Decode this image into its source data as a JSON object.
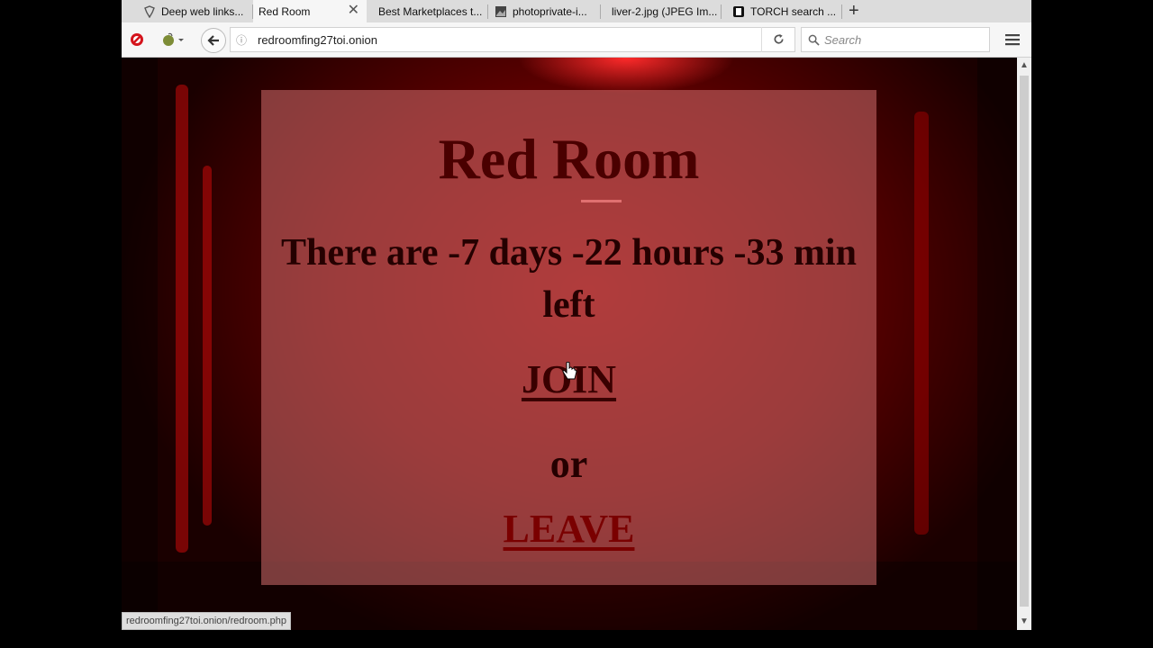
{
  "tabs": [
    {
      "label": "Deep web links...",
      "active": false
    },
    {
      "label": "Red Room",
      "active": true
    },
    {
      "label": "Best Marketplaces t...",
      "active": false
    },
    {
      "label": "photoprivate-i...",
      "active": false
    },
    {
      "label": "liver-2.jpg (JPEG Im...",
      "active": false
    },
    {
      "label": "TORCH search ...",
      "active": false
    }
  ],
  "navbar": {
    "url": "redroomfing27toi.onion",
    "search_placeholder": "Search"
  },
  "page": {
    "title": "Red Room",
    "countdown": "There are -7 days -22 hours -33 min left",
    "join_label": "JOIN",
    "or_label": "or",
    "leave_label": "LEAVE"
  },
  "status_url": "redroomfing27toi.onion/redroom.php",
  "colors": {
    "title": "#4a0000",
    "leave_link": "#7a0000",
    "background": "#8a0000"
  }
}
